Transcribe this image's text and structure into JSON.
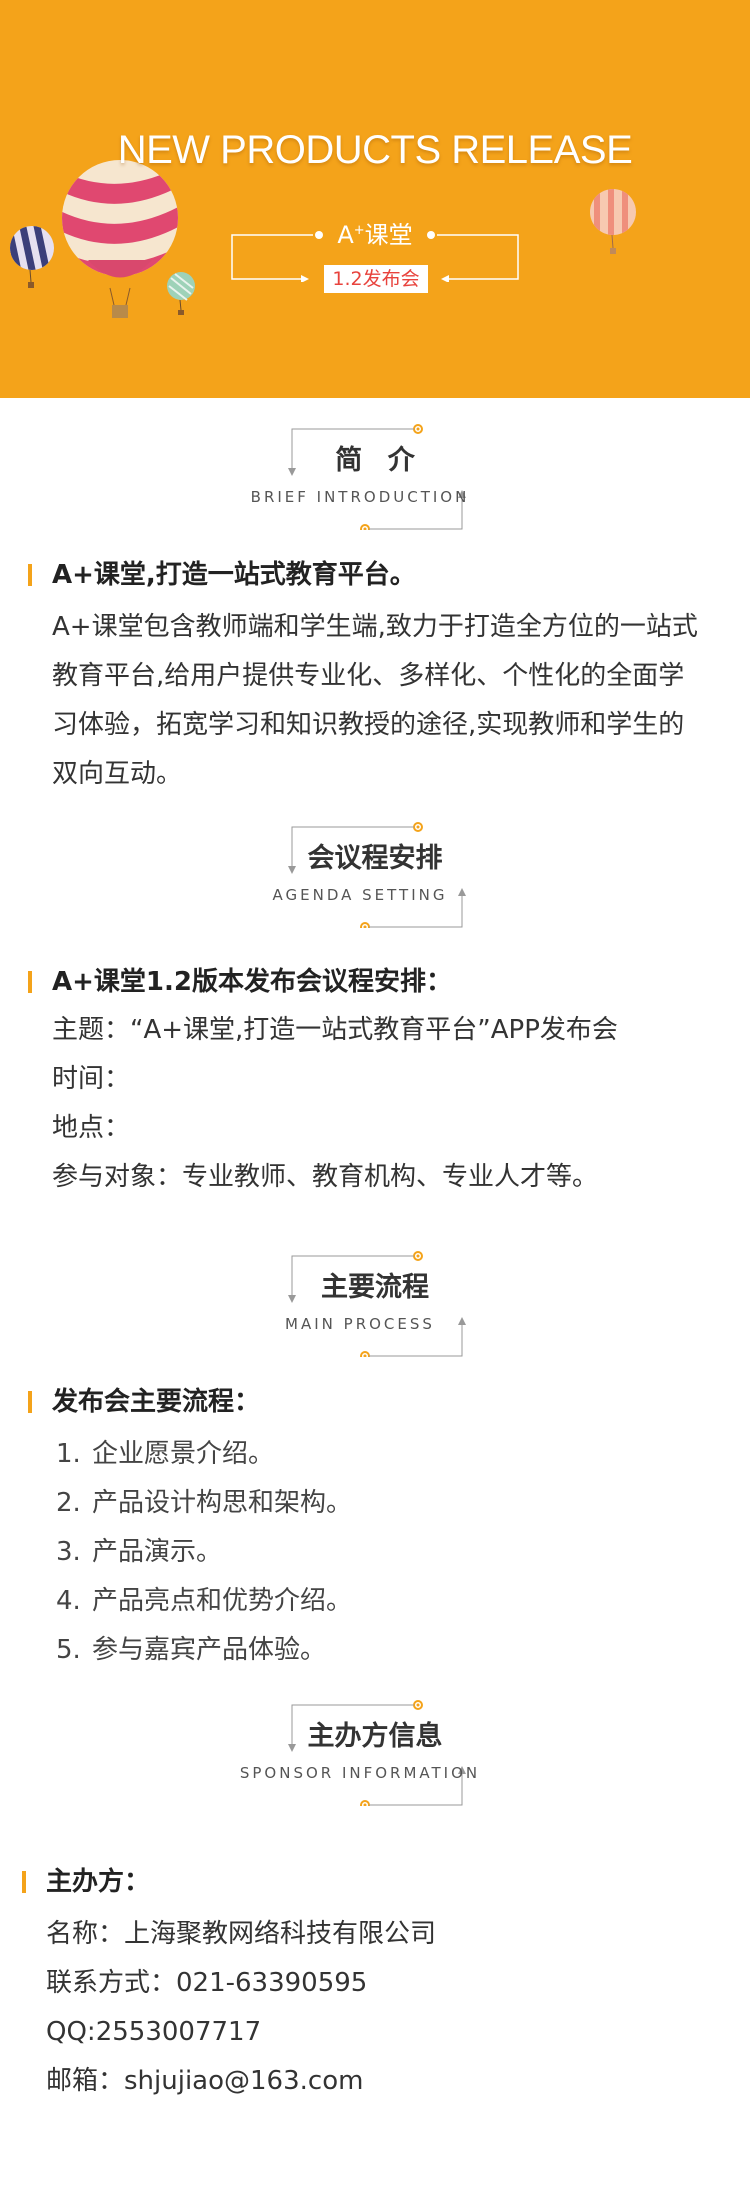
{
  "banner": {
    "title": "NEW PRODUCTS RELEASE",
    "subtitle_main": "A",
    "subtitle_sup": "+",
    "subtitle_rest": "课堂",
    "tag": "1.2发布会",
    "bg_color": "#f4a31a"
  },
  "sections": {
    "intro": {
      "title": "简 介",
      "subtitle": "BRIEF INTRODUCTION",
      "heading": "A+课堂,打造一站式教育平台。",
      "lines": [
        "A+课堂包含教师端和学生端,致力于打造全方位的一站式",
        "教育平台,给用户提供专业化、多样化、个性化的全面学",
        "习体验，拓宽学习和知识教授的途径,实现教师和学生的",
        "双向互动。"
      ]
    },
    "agenda": {
      "title": "会议程安排",
      "subtitle": "AGENDA SETTING",
      "heading": "A+课堂1.2版本发布会议程安排：",
      "lines": [
        "主题：“A+课堂,打造一站式教育平台”APP发布会",
        "时间：",
        "地点：",
        "参与对象：专业教师、教育机构、专业人才等。"
      ]
    },
    "process": {
      "title": "主要流程",
      "subtitle": "MAIN PROCESS",
      "heading": "发布会主要流程：",
      "items": [
        {
          "num": "1.",
          "text": "企业愿景介绍。"
        },
        {
          "num": "2.",
          "text": "产品设计构思和架构。"
        },
        {
          "num": "3.",
          "text": "产品演示。"
        },
        {
          "num": "4.",
          "text": "产品亮点和优势介绍。"
        },
        {
          "num": "5.",
          "text": "参与嘉宾产品体验。"
        }
      ]
    },
    "sponsor": {
      "title": "主办方信息",
      "subtitle": "SPONSOR INFORMATION",
      "heading": "主办方：",
      "lines": [
        "名称：上海聚教网络科技有限公司",
        "联系方式：021-63390595",
        "QQ:2553007717",
        "邮箱：shjujiao@163.com"
      ]
    }
  },
  "colors": {
    "accent": "#f4a31a",
    "tag_text": "#e8433d",
    "text": "#333333"
  }
}
